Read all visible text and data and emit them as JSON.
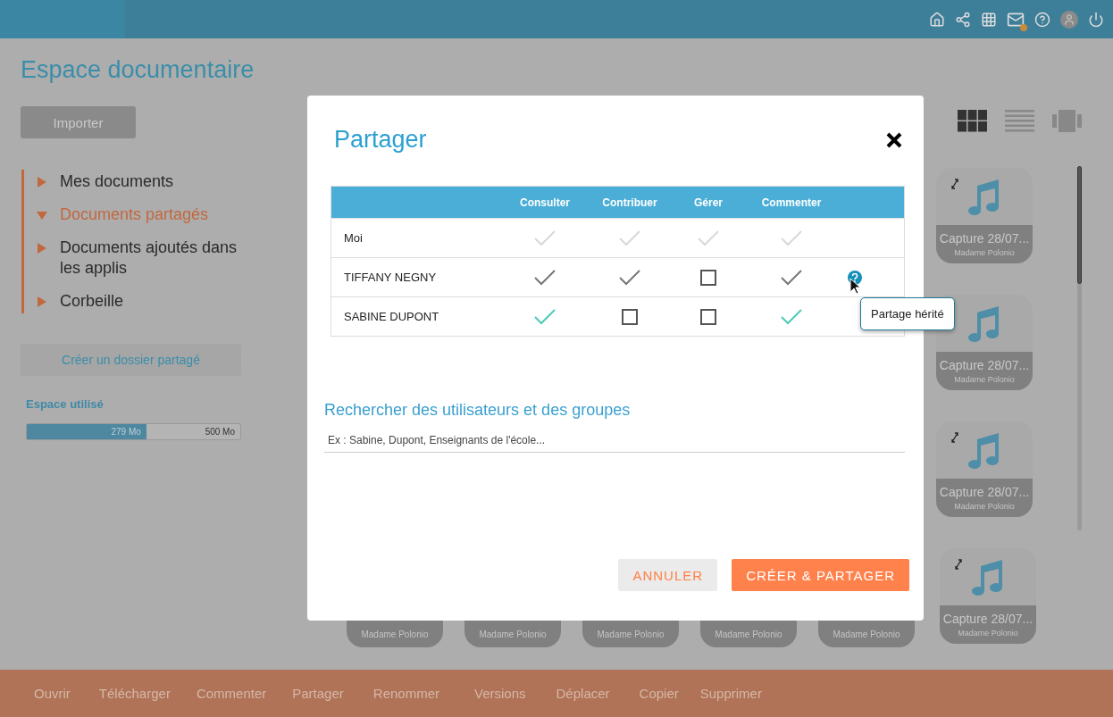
{
  "page_title": "Espace documentaire",
  "import_button": "Importer",
  "nav": [
    {
      "label": "Mes documents",
      "selected": false,
      "expanded": false
    },
    {
      "label": "Documents partagés",
      "selected": true,
      "expanded": true
    },
    {
      "label": "Documents ajoutés dans les applis",
      "selected": false,
      "expanded": false
    },
    {
      "label": "Corbeille",
      "selected": false,
      "expanded": false
    }
  ],
  "create_folder_button": "Créer un dossier partagé",
  "storage": {
    "label": "Espace utilisé",
    "used": "279 Mo",
    "total": "500 Mo",
    "level": 0.56
  },
  "views": [
    {
      "kind": "grid",
      "selected": true
    },
    {
      "kind": "list",
      "selected": false
    },
    {
      "kind": "carousel",
      "selected": false
    }
  ],
  "side_cards": [
    {
      "title": "Capture 28/07...",
      "author": "Madame Polonio",
      "expand_icon": true
    },
    {
      "title": "Capture 28/07...",
      "author": "Madame Polonio",
      "expand_icon": false
    },
    {
      "title": "Capture 28/07...",
      "author": "Madame Polonio",
      "expand_icon": true
    },
    {
      "title": "Capture 28/07...",
      "author": "Madame Polonio",
      "expand_icon": true
    }
  ],
  "bottom_cards": [
    {
      "author": "Madame Polonio"
    },
    {
      "author": "Madame Polonio"
    },
    {
      "author": "Madame Polonio"
    },
    {
      "author": "Madame Polonio"
    },
    {
      "author": "Madame Polonio"
    }
  ],
  "modal": {
    "title": "Partager",
    "table": {
      "columns": [
        "Consulter",
        "Contribuer",
        "Gérer",
        "Commenter"
      ],
      "rows": [
        {
          "name": "Moi",
          "disabled": true,
          "inherited": false,
          "permissions": [
            {
              "checked": true
            },
            {
              "checked": true
            },
            {
              "checked": true
            },
            {
              "checked": true
            }
          ]
        },
        {
          "name": "TIFFANY NEGNY",
          "disabled": false,
          "inherited": true,
          "tooltip": "Partage hérité",
          "permissions": [
            {
              "checked": true
            },
            {
              "checked": true
            },
            {
              "checked": false
            },
            {
              "checked": true
            }
          ]
        },
        {
          "name": "SABINE DUPONT",
          "disabled": false,
          "inherited": false,
          "permissions": [
            {
              "checked": true
            },
            {
              "checked": false
            },
            {
              "checked": false
            },
            {
              "checked": true
            }
          ]
        }
      ]
    },
    "search": {
      "label": "Rechercher des utilisateurs et des groupes",
      "placeholder": "Ex : Sabine, Dupont, Enseignants de l'école..."
    },
    "buttons": [
      {
        "label": "ANNULER",
        "kind": "secondary"
      },
      {
        "label": "CRÉER & PARTAGER",
        "kind": "primary"
      }
    ]
  },
  "actions": [
    "Ouvrir",
    "Télécharger",
    "Commenter",
    "Partager",
    "Renommer",
    "Versions",
    "Déplacer",
    "Copier",
    "Supprimer"
  ]
}
